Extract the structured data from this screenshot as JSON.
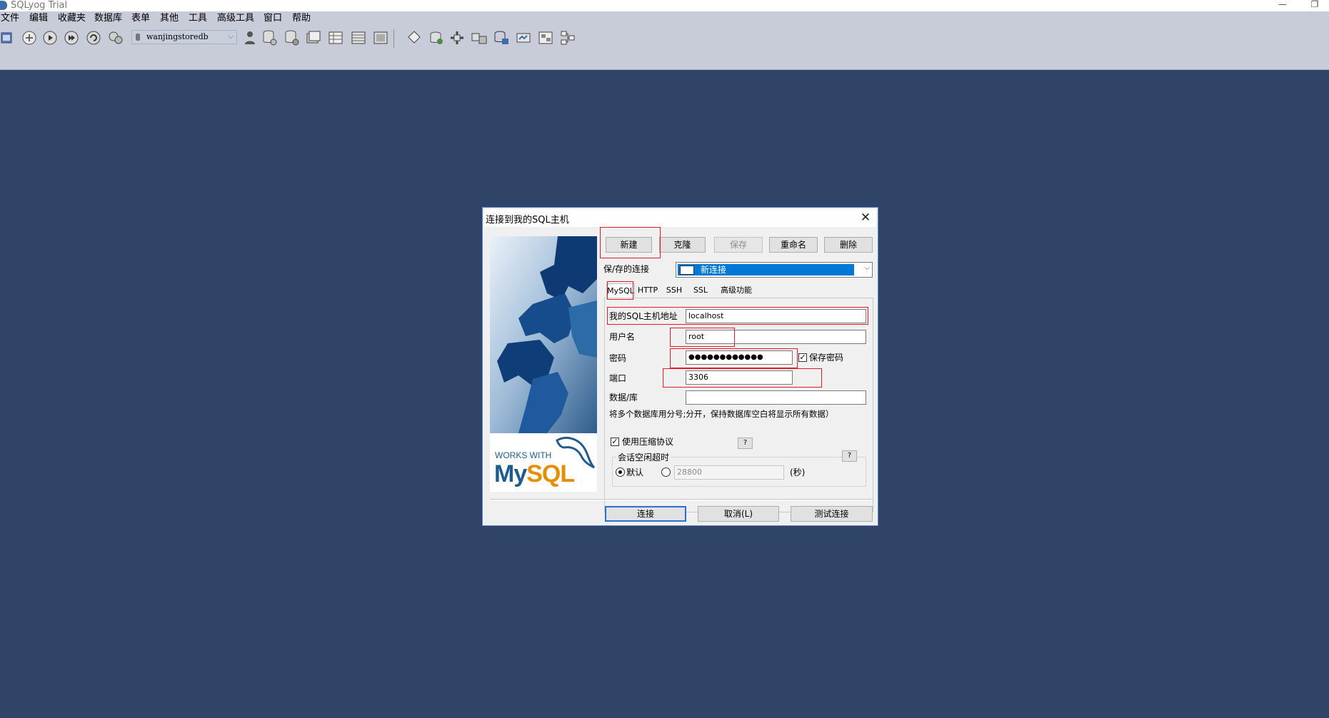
{
  "window": {
    "title": "SQLyog Trial",
    "minimize": "—",
    "restore": "❐"
  },
  "menu": [
    "文件",
    "编辑",
    "收藏夹",
    "数据库",
    "表单",
    "其他",
    "工具",
    "高级工具",
    "窗口",
    "帮助"
  ],
  "toolbar": {
    "db_selector": "wanjingstoredb",
    "icons": [
      "new-connection-icon",
      "connect-icon",
      "execute-icon",
      "execute-all-icon",
      "refresh-icon",
      "stop-icon",
      "user-icon",
      "db-create-icon",
      "db-alter-icon",
      "db-query-icon",
      "table-create-icon",
      "table-data-icon",
      "table-index-icon",
      "schema-icon",
      "import-icon",
      "export-icon",
      "sync-icon",
      "backup-icon",
      "restore-icon",
      "job-icon",
      "designer-icon",
      "scheduler-icon"
    ]
  },
  "dialog": {
    "title": "连接到我的SQL主机",
    "close": "✕",
    "buttons": {
      "new": "新建",
      "clone": "克隆",
      "save": "保存",
      "rename": "重命名",
      "delete": "删除"
    },
    "saved_label": "保/存的连接",
    "saved_value": "新连接",
    "tabs": [
      "MySQL",
      "HTTP",
      "SSH",
      "SSL",
      "高级功能"
    ],
    "active_tab": "MySQL",
    "fields": {
      "host_label": "我的SQL主机地址",
      "host_value": "localhost",
      "user_label": "用户名",
      "user_value": "root",
      "password_label": "密码",
      "password_value": "●●●●●●●●●●●●",
      "save_password_label": "保存密码",
      "save_password_checked": true,
      "port_label": "端口",
      "port_value": "3306",
      "database_label": "数据/库",
      "database_value": "",
      "database_hint": "将多个数据库用分号;分开，保持数据库空白将显示所有数据）"
    },
    "compression_label": "使用压缩协议",
    "compression_checked": true,
    "help": "?",
    "timeout_group_label": "会话空闲超时",
    "timeout_default_label": "默认",
    "timeout_value": "28800",
    "timeout_unit": "(秒)",
    "image": {
      "works_with": "WORKS WITH",
      "my": "My",
      "sql": "SQL"
    },
    "footer": {
      "connect": "连接",
      "cancel": "取消(L)",
      "test": "测试连接"
    }
  },
  "colors": {
    "desktop": "#2f4466",
    "toolbar": "#c7ccd8",
    "highlight": "#e31c23",
    "selection": "#0078d7"
  }
}
